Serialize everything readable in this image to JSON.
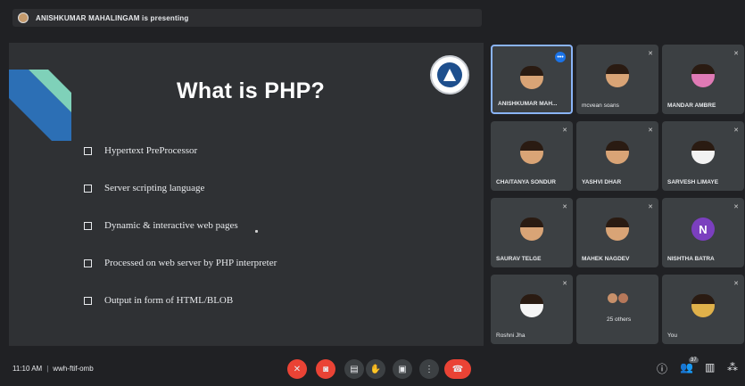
{
  "presenting": {
    "text": "ANISHKUMAR MAHALINGAM is presenting"
  },
  "slide": {
    "title": "What is PHP?",
    "bullets": [
      "Hypertext PreProcessor",
      "Server scripting language",
      "Dynamic & interactive web pages",
      "Processed on web server by PHP interpreter",
      "Output in form of HTML/BLOB"
    ],
    "accent_colors": [
      "#2c6fb5",
      "#7fd1b9"
    ]
  },
  "participants": [
    {
      "name": "ANISHKUMAR MAH...",
      "avatar": "photo",
      "active": true,
      "icon": "more-options-icon"
    },
    {
      "name": "mcvean soans",
      "avatar": "photo",
      "icon": "mic-off-icon"
    },
    {
      "name": "MANDAR AMBRE",
      "avatar": "photo",
      "icon": "mic-off-icon"
    },
    {
      "name": "CHAITANYA SONDUR",
      "avatar": "photo",
      "icon": "mic-off-icon"
    },
    {
      "name": "YASHVI DHAR",
      "avatar": "photo",
      "icon": "mic-off-icon"
    },
    {
      "name": "SARVESH LIMAYE",
      "avatar": "photo",
      "icon": "mic-off-icon"
    },
    {
      "name": "SAURAV TELGE",
      "avatar": "photo",
      "icon": "mic-off-icon"
    },
    {
      "name": "MAHEK NAGDEV",
      "avatar": "photo",
      "icon": "mic-off-icon"
    },
    {
      "name": "NISHTHA BATRA",
      "avatar": "N",
      "icon": "mic-off-icon"
    },
    {
      "name": "Roshni Jha",
      "avatar": "photo",
      "icon": "mic-off-icon"
    },
    {
      "name": "25 others",
      "avatar": "group"
    },
    {
      "name": "You",
      "avatar": "photo",
      "icon": "mic-off-icon"
    }
  ],
  "bottom": {
    "time": "11:10 AM",
    "meeting_code": "wwh-ftif-omb",
    "participant_count": "37"
  },
  "controls": [
    {
      "name": "mic-toggle-button",
      "icon": "mic-off-icon",
      "glyph": "✕",
      "style": "red"
    },
    {
      "name": "camera-toggle-button",
      "icon": "camera-off-icon",
      "glyph": "◙",
      "style": "red"
    },
    {
      "name": "captions-button",
      "icon": "captions-icon",
      "glyph": "▤",
      "style": "dark"
    },
    {
      "name": "raise-hand-button",
      "icon": "hand-icon",
      "glyph": "✋",
      "style": "dark"
    },
    {
      "name": "present-screen-button",
      "icon": "present-icon",
      "glyph": "▣",
      "style": "dark"
    },
    {
      "name": "more-options-button",
      "icon": "more-vert-icon",
      "glyph": "⋮",
      "style": "dark"
    },
    {
      "name": "end-call-button",
      "icon": "call-end-icon",
      "glyph": "☎",
      "style": "end"
    }
  ],
  "right_controls": [
    {
      "name": "meeting-details-button",
      "icon": "info-icon",
      "glyph": "ⓘ"
    },
    {
      "name": "people-button",
      "icon": "people-icon",
      "glyph": "👥"
    },
    {
      "name": "chat-button",
      "icon": "chat-icon",
      "glyph": "▥"
    },
    {
      "name": "activities-button",
      "icon": "activities-icon",
      "glyph": "⁂"
    }
  ]
}
